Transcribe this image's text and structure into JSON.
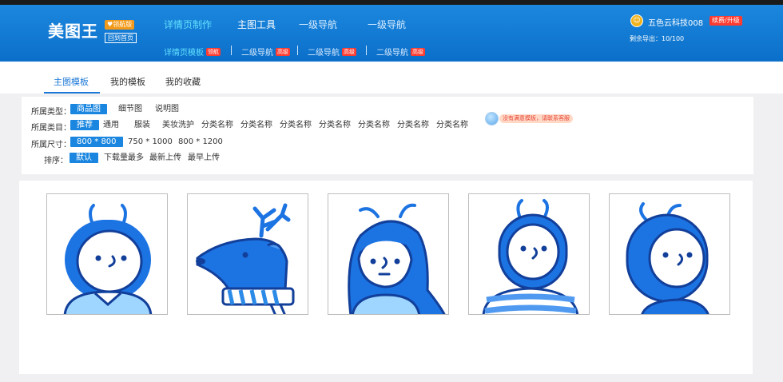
{
  "header": {
    "logo": "美图王",
    "vip_badge": "领航版",
    "home_button": "回到首页",
    "nav_primary": [
      {
        "label": "详情页制作"
      },
      {
        "label": "主图工具"
      },
      {
        "label": "一级导航"
      },
      {
        "label": "一级导航"
      }
    ],
    "nav_secondary": [
      {
        "label": "详情页模板",
        "tag": "领航"
      },
      {
        "label": "二级导航",
        "tag": "高级"
      },
      {
        "label": "二级导航",
        "tag": "高级"
      },
      {
        "label": "二级导航",
        "tag": "高级"
      }
    ],
    "user": {
      "name": "五色云科技008",
      "renew": "续费/升级",
      "quota": "剩余导出：10/100"
    }
  },
  "tabs": [
    {
      "label": "主图模板",
      "active": true
    },
    {
      "label": "我的模板",
      "active": false
    },
    {
      "label": "我的收藏",
      "active": false
    }
  ],
  "filters": {
    "type": {
      "label": "所属类型：",
      "options": [
        "商品图",
        "细节图",
        "说明图"
      ],
      "selected": "商品图"
    },
    "category": {
      "label": "所属类目：",
      "options": [
        "推荐",
        "通用",
        "服装",
        "美妆洗护",
        "分类名称",
        "分类名称",
        "分类名称",
        "分类名称",
        "分类名称",
        "分类名称",
        "分类名称"
      ],
      "selected": "推荐"
    },
    "size": {
      "label": "所属尺寸：",
      "options": [
        "800 * 800",
        "750 * 1000",
        "800 * 1200"
      ],
      "selected": "800 * 800"
    },
    "sort": {
      "label": "排序：",
      "options": [
        "默认",
        "下载量最多",
        "最新上传",
        "最早上传"
      ],
      "selected": "默认"
    }
  },
  "helper": {
    "text": "没有满意模板，请联系客服"
  },
  "templates": [
    {
      "name": "antenna-boy"
    },
    {
      "name": "deer"
    },
    {
      "name": "girl"
    },
    {
      "name": "striped-robot"
    },
    {
      "name": "side-robot"
    }
  ],
  "colors": {
    "header_blue": "#0b6fc9",
    "accent": "#1a86e0",
    "tag_red": "#ff3b30",
    "illustration_blue": "#1c73e2"
  }
}
